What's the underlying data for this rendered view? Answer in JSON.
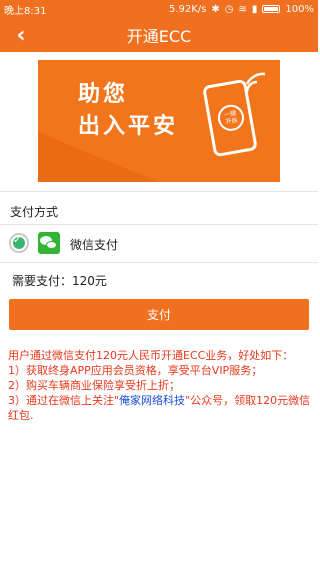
{
  "status_bar": {
    "time": "晚上8:31",
    "speed": "5.92K/s",
    "battery": "100%"
  },
  "header": {
    "back_icon": "chevron-left-icon",
    "title": "开通ECC"
  },
  "banner": {
    "line1": "助您",
    "line2": "出入平安",
    "phone_label_1": "一键",
    "phone_label_2": "开启"
  },
  "payment": {
    "section_label": "支付方式",
    "method": "微信支付",
    "selected": true,
    "amount_label": "需要支付：120元",
    "button_label": "支付"
  },
  "notes": {
    "line1": "用户通过微信支付120元人民币开通ECC业务，好处如下：",
    "line2": "1）获取终身APP应用会员资格，享受平台VIP服务；",
    "line3": "2）购买车辆商业保险享受折上折；",
    "line4_prefix": "3）通过在微信上关注\"",
    "line4_highlight": "俺家网络科技",
    "line4_suffix": "\"公众号，领取120元微信红包."
  },
  "colors": {
    "accent": "#f0701f",
    "note_text": "#e8391b",
    "highlight": "#1a4ddb",
    "wechat_green": "#32b434"
  }
}
